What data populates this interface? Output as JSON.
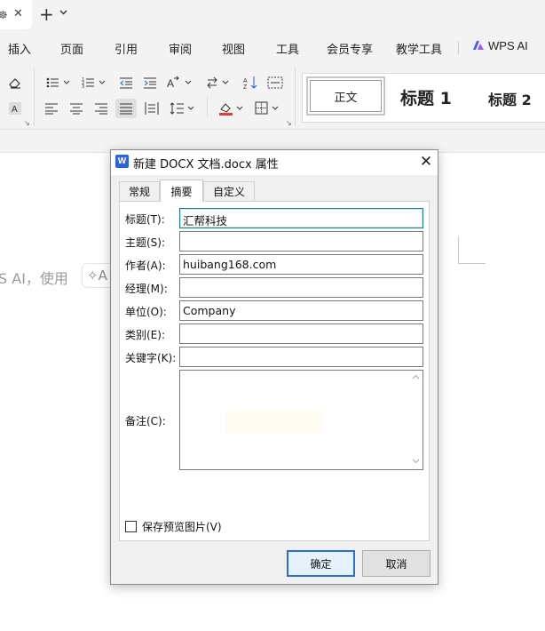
{
  "tabstrip": {
    "doc_tab_icon": "☸",
    "close": "✕",
    "new_tab": "+",
    "new_tab_menu": "⌄"
  },
  "menu": {
    "items": [
      "插入",
      "页面",
      "引用",
      "审阅",
      "视图",
      "工具",
      "会员专享",
      "教学工具"
    ],
    "wps_ai": "WPS AI",
    "colors": {
      "ai_logo": "#4b5cf0"
    }
  },
  "styles": {
    "normal": "正文",
    "heading1": "标题 1",
    "heading2": "标题 2"
  },
  "document": {
    "hint_text": "S AI，使用",
    "chip_text": "✧A"
  },
  "dialog": {
    "title": "新建 DOCX 文档.docx 属性",
    "icon_letter": "W",
    "close": "✕",
    "tabs": [
      "常规",
      "摘要",
      "自定义"
    ],
    "active_tab": "摘要",
    "fields": [
      {
        "label": "标题(T):",
        "value": "汇帮科技"
      },
      {
        "label": "主题(S):",
        "value": ""
      },
      {
        "label": "作者(A):",
        "value": "huibang168.com"
      },
      {
        "label": "经理(M):",
        "value": ""
      },
      {
        "label": "单位(O):",
        "value": "Company"
      },
      {
        "label": "类别(E):",
        "value": ""
      },
      {
        "label": "关键字(K):",
        "value": ""
      }
    ],
    "notes_label": "备注(C):",
    "notes_value": "",
    "save_preview_label": "保存预览图片(V)",
    "save_preview_checked": false,
    "ok_label": "确定",
    "cancel_label": "取消",
    "colors": {
      "primary_border": "#2a6fc9",
      "focus_border": "#1f7a8c",
      "word_icon": "#2b64d8"
    }
  }
}
